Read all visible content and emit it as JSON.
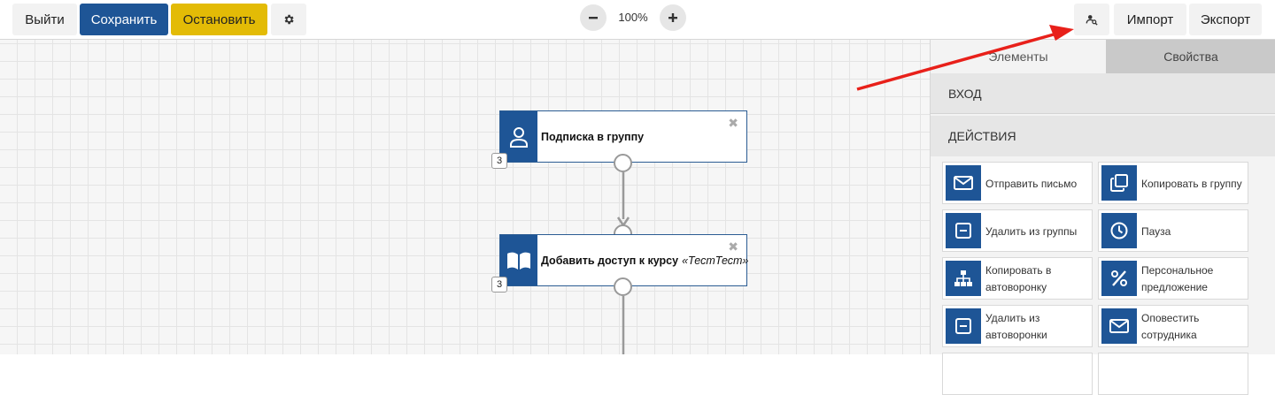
{
  "toolbar": {
    "exit_label": "Выйти",
    "save_label": "Сохранить",
    "stop_label": "Остановить",
    "zoom_level": "100%",
    "import_label": "Импорт",
    "export_label": "Экспорт"
  },
  "canvas": {
    "nodes": [
      {
        "title": "Подписка в группу",
        "subtitle": "",
        "counter": "3",
        "icon": "user-icon"
      },
      {
        "title": "Добавить доступ к курсу",
        "subtitle": "«ТестТест»",
        "counter": "3",
        "icon": "book-icon"
      }
    ]
  },
  "sidebar": {
    "tabs": {
      "elements": "Элементы",
      "properties": "Свойства"
    },
    "section_in": "ВХОД",
    "section_actions": "ДЕЙСТВИЯ",
    "actions": [
      {
        "label": "Отправить письмо",
        "icon": "mail-icon"
      },
      {
        "label": "Копировать в группу",
        "icon": "copy-icon"
      },
      {
        "label": "Удалить из группы",
        "icon": "minus-icon"
      },
      {
        "label": "Пауза",
        "icon": "clock-icon"
      },
      {
        "label": "Копировать в автоворонку",
        "icon": "hierarchy-icon"
      },
      {
        "label": "Персональное предложение",
        "icon": "percent-icon"
      },
      {
        "label": "Удалить из автоворонки",
        "icon": "minus-icon"
      },
      {
        "label": "Оповестить сотрудника",
        "icon": "mail-icon"
      }
    ]
  },
  "colors": {
    "primary": "#1e5596",
    "warning": "#e3bb06",
    "annotation_arrow": "#e8201a"
  }
}
